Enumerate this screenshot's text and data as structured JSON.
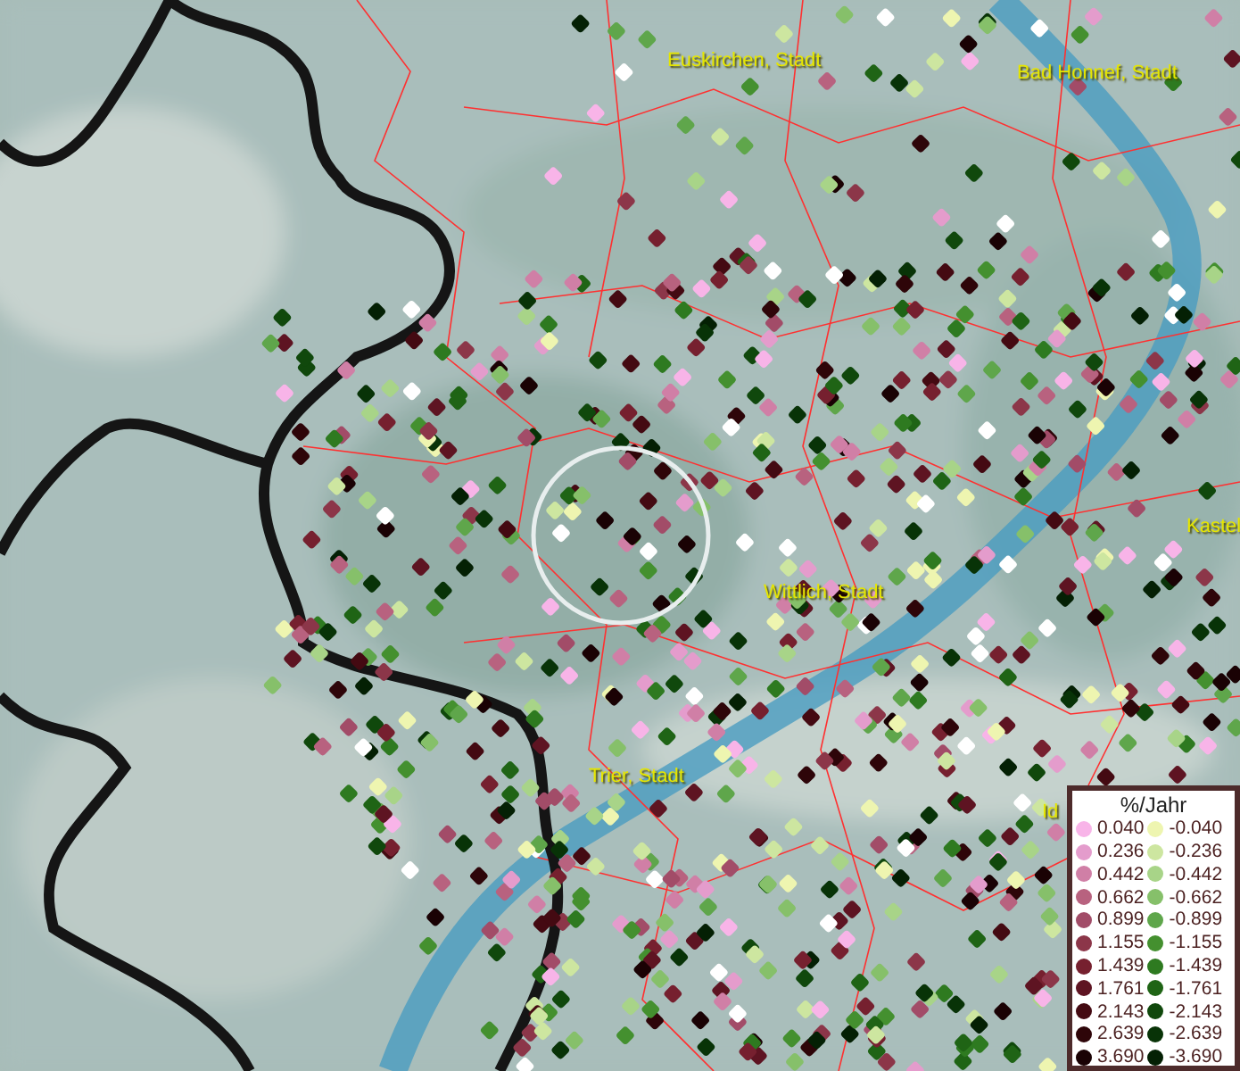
{
  "place_labels": [
    {
      "text": "Euskirchen, Stadt"
    },
    {
      "text": "Bad Honnef, Stadt"
    },
    {
      "text": "Kastel"
    },
    {
      "text": "Wittlich, Stadt"
    },
    {
      "text": "Trier, Stadt"
    },
    {
      "text": "Id"
    }
  ],
  "legend": {
    "title": "%/Jahr",
    "columns": [
      {
        "entries": [
          {
            "value": "0.040",
            "color": "#f8b4e8"
          },
          {
            "value": "0.236",
            "color": "#e49ccc"
          },
          {
            "value": "0.442",
            "color": "#d07fa6"
          },
          {
            "value": "0.662",
            "color": "#b8627f"
          },
          {
            "value": "0.899",
            "color": "#a24c68"
          },
          {
            "value": "1.155",
            "color": "#8c3649"
          },
          {
            "value": "1.439",
            "color": "#76202f"
          },
          {
            "value": "1.761",
            "color": "#5e1422"
          },
          {
            "value": "2.143",
            "color": "#440a12"
          },
          {
            "value": "2.639",
            "color": "#2e0509"
          },
          {
            "value": "3.690",
            "color": "#1a0204"
          }
        ]
      },
      {
        "entries": [
          {
            "value": "-0.040",
            "color": "#eef5b0"
          },
          {
            "value": "-0.236",
            "color": "#cde6a0"
          },
          {
            "value": "-0.442",
            "color": "#a8d488"
          },
          {
            "value": "-0.662",
            "color": "#86c06a"
          },
          {
            "value": "-0.899",
            "color": "#5fa64b"
          },
          {
            "value": "-1.155",
            "color": "#44902f"
          },
          {
            "value": "-1.439",
            "color": "#2e7a20"
          },
          {
            "value": "-1.761",
            "color": "#1f6415"
          },
          {
            "value": "-2.143",
            "color": "#10480c"
          },
          {
            "value": "-2.639",
            "color": "#083307"
          },
          {
            "value": "-3.690",
            "color": "#042004"
          }
        ]
      }
    ]
  }
}
